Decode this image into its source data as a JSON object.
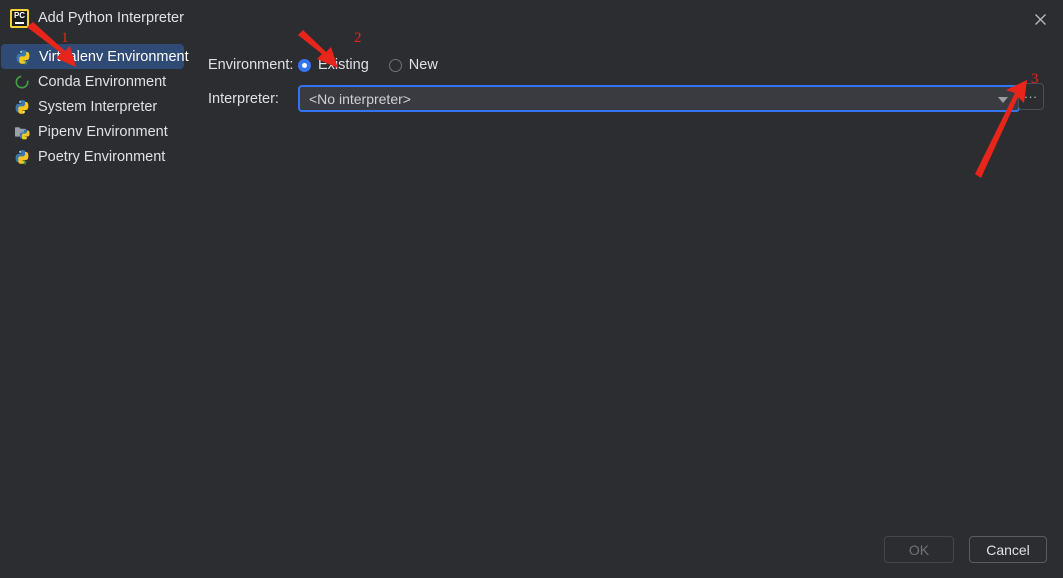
{
  "window": {
    "title": "Add Python Interpreter",
    "app_icon": "pycharm-icon",
    "app_icon_text": "PC",
    "close_icon": "close-icon"
  },
  "sidebar": {
    "items": [
      {
        "label": "Virtualenv Environment",
        "icon": "python-venv-icon",
        "selected": true
      },
      {
        "label": "Conda Environment",
        "icon": "conda-icon",
        "selected": false
      },
      {
        "label": "System Interpreter",
        "icon": "python-icon",
        "selected": false
      },
      {
        "label": "Pipenv Environment",
        "icon": "pipenv-folder-icon",
        "selected": false
      },
      {
        "label": "Poetry Environment",
        "icon": "poetry-icon",
        "selected": false
      }
    ]
  },
  "form": {
    "environment_label": "Environment:",
    "radios": [
      {
        "label": "Existing",
        "selected": true
      },
      {
        "label": "New",
        "selected": false
      }
    ],
    "interpreter_label": "Interpreter:",
    "interpreter_value": "<No interpreter>",
    "interpreter_placeholder": "<No interpreter>",
    "dropdown_icon": "chevron-down-icon",
    "browse_button_label": "...",
    "browse_button_icon": "ellipsis-icon"
  },
  "footer": {
    "ok_label": "OK",
    "cancel_label": "Cancel"
  },
  "annotations": {
    "marker_1": "1",
    "marker_2": "2",
    "marker_3": "3",
    "arrow_color": "#e8251b"
  },
  "colors": {
    "background": "#2b2d30",
    "selection": "#2f4a75",
    "accent": "#3574f0",
    "field_background": "#393b40",
    "text": "#dfe1e5",
    "annotation_red": "#e8251b"
  }
}
